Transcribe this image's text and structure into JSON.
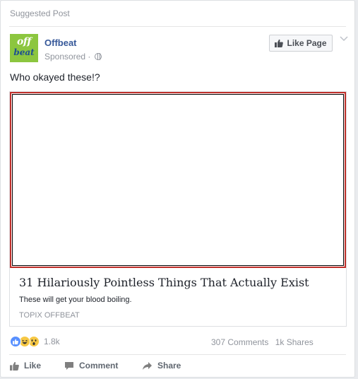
{
  "header": {
    "label": "Suggested Post"
  },
  "page": {
    "logo_line1": "off",
    "logo_line2": "beat",
    "name": "Offbeat",
    "sponsored": "Sponsored ·"
  },
  "like_page_button": {
    "label": "Like Page"
  },
  "post": {
    "text": "Who okayed these!?"
  },
  "link": {
    "title": "31 Hilariously Pointless Things That Actually Exist",
    "description": "These will get your blood boiling.",
    "domain": "TOPIX OFFBEAT"
  },
  "engagement": {
    "reaction_count": "1.8k",
    "comments": "307 Comments",
    "shares": "1k Shares"
  },
  "actions": {
    "like": "Like",
    "comment": "Comment",
    "share": "Share"
  },
  "colors": {
    "link_blue": "#365899",
    "like_blue": "#5890ff",
    "logo_green": "#8cc63f",
    "media_border": "#c0302b"
  }
}
